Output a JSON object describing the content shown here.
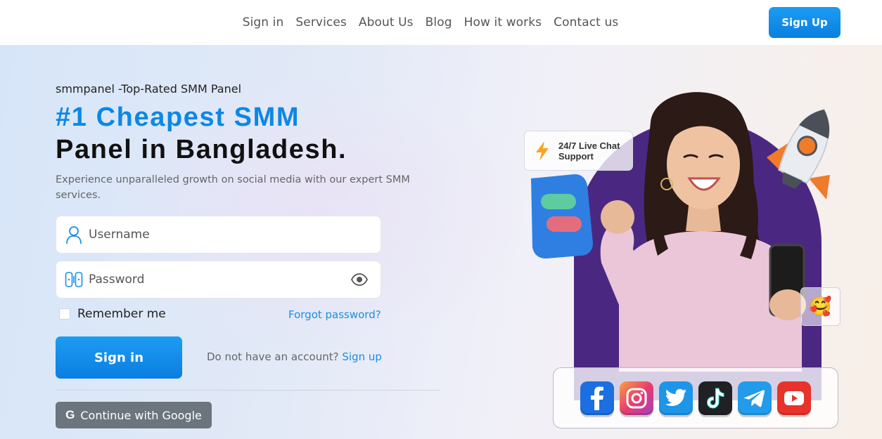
{
  "nav": {
    "links": [
      "Sign in",
      "Services",
      "About Us",
      "Blog",
      "How it works",
      "Contact us"
    ],
    "signup_label": "Sign Up"
  },
  "hero": {
    "tagline": "smmpanel -Top-Rated SMM Panel",
    "headline_line1": "#1 Cheapest SMM",
    "headline_line2": "Panel in Bangladesh.",
    "description": "Experience unparalleled growth on social media with our expert SMM services."
  },
  "form": {
    "username_placeholder": "Username",
    "password_placeholder": "Password",
    "remember_label": "Remember me",
    "forgot_label": "Forgot password?",
    "signin_label": "Sign in",
    "no_account_text": "Do not have an account?",
    "signup_link_label": "Sign up",
    "google_g": "G",
    "google_label": "Continue with Google"
  },
  "illustration": {
    "live_chat_text": "24/7 Live Chat\nSupport",
    "emoji": "🥰",
    "social_icons": [
      "facebook-icon",
      "instagram-icon",
      "twitter-icon",
      "tiktok-icon",
      "telegram-icon",
      "youtube-icon"
    ]
  },
  "colors": {
    "accent": "#0c87e6",
    "button_blue": "#1a8fe3",
    "google_button": "#6c757d",
    "arch_purple": "#4a2882"
  }
}
